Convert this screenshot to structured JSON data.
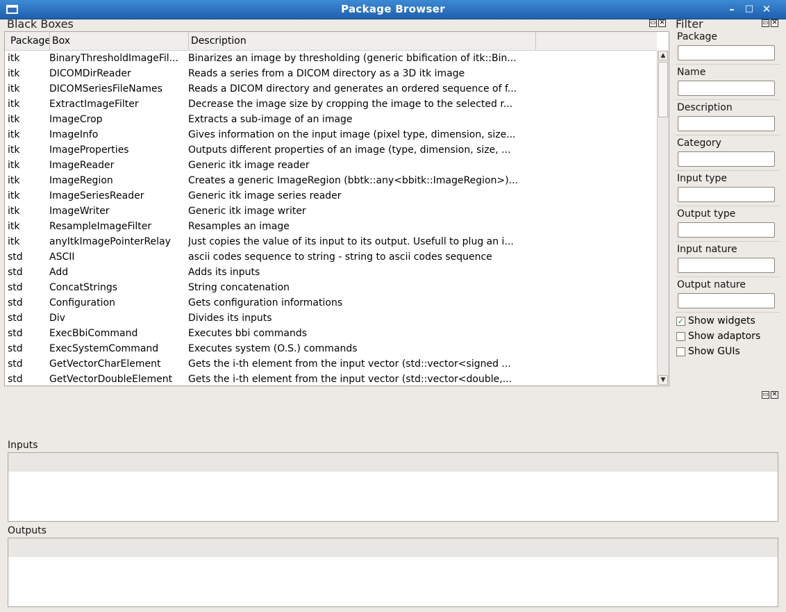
{
  "window": {
    "title": "Package Browser",
    "buttons": {
      "minimize": "–",
      "maximize": "□",
      "close": "✕"
    }
  },
  "blackboxes": {
    "title": "Black Boxes",
    "columns": [
      "Package",
      "Box",
      "Description"
    ],
    "rows": [
      [
        "itk",
        "BinaryThresholdImageFil...",
        "Binarizes an image by thresholding (generic bbification of itk::Bin..."
      ],
      [
        "itk",
        "DICOMDirReader",
        "Reads a series from a DICOM directory as a 3D itk image"
      ],
      [
        "itk",
        "DICOMSeriesFileNames",
        "Reads a DICOM directory and generates an ordered sequence of f..."
      ],
      [
        "itk",
        "ExtractImageFilter",
        "Decrease the image size by cropping the image to the selected r..."
      ],
      [
        "itk",
        "ImageCrop",
        "Extracts a sub-image of an image"
      ],
      [
        "itk",
        "ImageInfo",
        "Gives information on the input image (pixel type, dimension, size..."
      ],
      [
        "itk",
        "ImageProperties",
        "Outputs different properties of an image (type, dimension, size, ..."
      ],
      [
        "itk",
        "ImageReader",
        "Generic itk image reader"
      ],
      [
        "itk",
        "ImageRegion",
        "Creates a generic ImageRegion (bbtk::any<bbitk::ImageRegion>)..."
      ],
      [
        "itk",
        "ImageSeriesReader",
        "Generic itk image series reader"
      ],
      [
        "itk",
        "ImageWriter",
        "Generic itk image writer"
      ],
      [
        "itk",
        "ResampleImageFilter",
        "Resamples an image"
      ],
      [
        "itk",
        "anyItkImagePointerRelay",
        "Just copies the value of its input to its output. Usefull to plug an i..."
      ],
      [
        "std",
        "ASCII",
        "ascii codes sequence to string - string to ascii codes sequence"
      ],
      [
        "std",
        "Add",
        "Adds its inputs"
      ],
      [
        "std",
        "ConcatStrings",
        "String concatenation"
      ],
      [
        "std",
        "Configuration",
        "Gets configuration informations"
      ],
      [
        "std",
        "Div",
        "Divides its inputs"
      ],
      [
        "std",
        "ExecBbiCommand",
        "Executes bbi commands"
      ],
      [
        "std",
        "ExecSystemCommand",
        "Executes system (O.S.) commands"
      ],
      [
        "std",
        "GetVectorCharElement",
        "Gets the i-th element from the input vector (std::vector<signed ..."
      ],
      [
        "std",
        "GetVectorDoubleElement",
        "Gets the i-th element from the input vector (std::vector<double,..."
      ]
    ]
  },
  "filter": {
    "title": "Filter",
    "fields": [
      {
        "label": "Package",
        "value": ""
      },
      {
        "label": "Name",
        "value": ""
      },
      {
        "label": "Description",
        "value": ""
      },
      {
        "label": "Category",
        "value": ""
      },
      {
        "label": "Input type",
        "value": ""
      },
      {
        "label": "Output type",
        "value": ""
      },
      {
        "label": "Input nature",
        "value": ""
      },
      {
        "label": "Output nature",
        "value": ""
      }
    ],
    "checkboxes": [
      {
        "label": "Show widgets",
        "checked": true
      },
      {
        "label": "Show adaptors",
        "checked": false
      },
      {
        "label": "Show GUIs",
        "checked": false
      }
    ]
  },
  "details": {
    "inputs_label": "Inputs",
    "outputs_label": "Outputs"
  }
}
